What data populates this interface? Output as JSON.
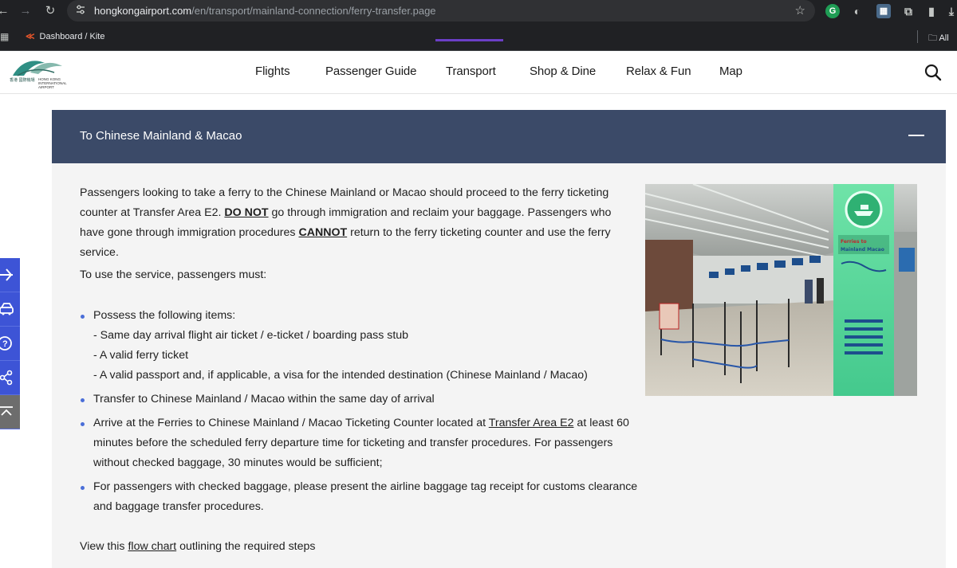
{
  "browser": {
    "url_host": "hongkongairport.com",
    "url_path": "/en/transport/mainland-connection/ferry-transfer.page",
    "bookmark": "Dashboard / Kite",
    "all_bookmarks": "All"
  },
  "site": {
    "logo_cn": "香港 國際機場",
    "logo_en": "HONG KONG INTERNATIONAL AIRPORT",
    "nav": [
      "Flights",
      "Passenger Guide",
      "Transport",
      "Shop & Dine",
      "Relax & Fun",
      "Map"
    ],
    "active_nav": "Transport"
  },
  "accordion": {
    "title": "To Chinese Mainland & Macao"
  },
  "content": {
    "p1_a": "Passengers looking to take a ferry to the Chinese Mainland or Macao should proceed to the ferry ticketing counter at Transfer Area E2. ",
    "p1_donot": "DO NOT",
    "p1_b": " go through immigration and reclaim your baggage. Passengers who have gone through immigration procedures ",
    "p1_cannot": "CANNOT",
    "p1_c": " return to the ferry ticketing counter and use the ferry service.",
    "p2": "To use the service, passengers must:",
    "b1_head": "Possess the following items:",
    "b1_items": [
      "- Same day arrival flight air ticket / e-ticket / boarding pass stub",
      "- A valid ferry ticket",
      "- A valid passport and, if applicable, a visa for the intended destination (Chinese Mainland / Macao)"
    ],
    "b2": "Transfer to Chinese Mainland / Macao within the same day of arrival",
    "b3_a": "Arrive at the Ferries to Chinese Mainland / Macao Ticketing Counter located at ",
    "b3_link": "Transfer Area E2",
    "b3_b": " at least 60 minutes before the scheduled ferry departure time for ticketing and transfer procedures. For passengers without checked baggage, 30 minutes would be sufficient;",
    "b4": "For passengers with checked baggage, please present the airline baggage tag receipt for customs clearance and baggage transfer procedures.",
    "flow_a": "View this ",
    "flow_link": "flow chart",
    "flow_b": " outlining the required steps"
  },
  "photo": {
    "sign_text": "Ferries to Mainland Macao"
  },
  "float_toolbar": [
    "plane-icon",
    "car-icon",
    "question-icon",
    "share-icon",
    "back-to-top-icon"
  ],
  "colors": {
    "accordion_header": "#3b4a68",
    "accent_purple": "#6b3fc6",
    "float_blue": "#3d54d6",
    "bullet": "#4a6ed8"
  }
}
